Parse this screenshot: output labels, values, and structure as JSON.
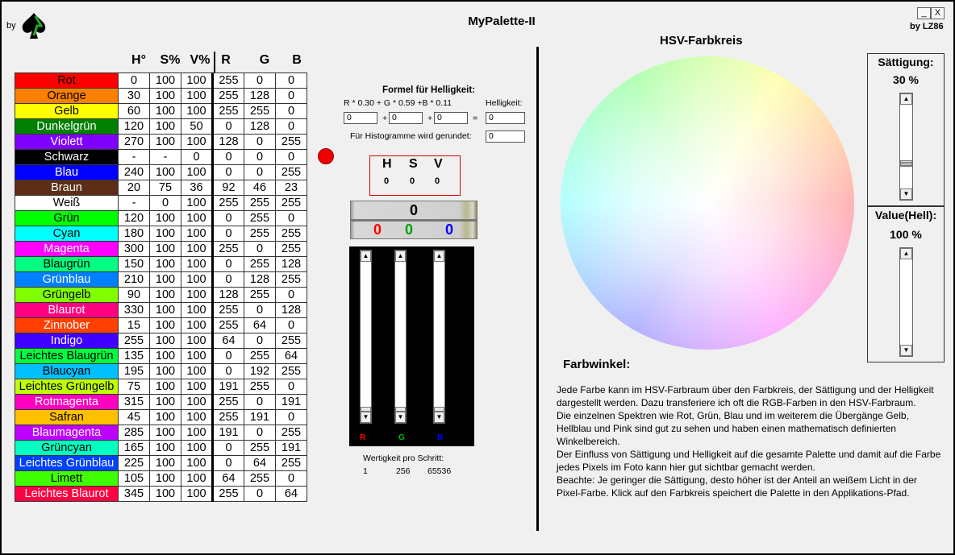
{
  "header": {
    "by_left": "by",
    "title": "MyPalette-II",
    "by_right": "by LZ86",
    "min_label": "_",
    "close_label": "X"
  },
  "table": {
    "headers": [
      "H°",
      "S%",
      "V%",
      "R",
      "G",
      "B"
    ],
    "rows": [
      {
        "name": "Rot",
        "bg": "#ff0000",
        "fg": "#000000",
        "h": "0",
        "s": "100",
        "v": "100",
        "r": "255",
        "g": "0",
        "b": "0"
      },
      {
        "name": "Orange",
        "bg": "#ff8000",
        "fg": "#000000",
        "h": "30",
        "s": "100",
        "v": "100",
        "r": "255",
        "g": "128",
        "b": "0"
      },
      {
        "name": "Gelb",
        "bg": "#ffff00",
        "fg": "#000000",
        "h": "60",
        "s": "100",
        "v": "100",
        "r": "255",
        "g": "255",
        "b": "0"
      },
      {
        "name": "Dunkelgrün",
        "bg": "#008000",
        "fg": "#ffffff",
        "h": "120",
        "s": "100",
        "v": "50",
        "r": "0",
        "g": "128",
        "b": "0"
      },
      {
        "name": "Violett",
        "bg": "#8000ff",
        "fg": "#ffffff",
        "h": "270",
        "s": "100",
        "v": "100",
        "r": "128",
        "g": "0",
        "b": "255"
      },
      {
        "name": "Schwarz",
        "bg": "#000000",
        "fg": "#ffffff",
        "h": "-",
        "s": "-",
        "v": "0",
        "r": "0",
        "g": "0",
        "b": "0"
      },
      {
        "name": "Blau",
        "bg": "#0000ff",
        "fg": "#ffffff",
        "h": "240",
        "s": "100",
        "v": "100",
        "r": "0",
        "g": "0",
        "b": "255"
      },
      {
        "name": "Braun",
        "bg": "#5c2e17",
        "fg": "#ffffff",
        "h": "20",
        "s": "75",
        "v": "36",
        "r": "92",
        "g": "46",
        "b": "23"
      },
      {
        "name": "Weiß",
        "bg": "#ffffff",
        "fg": "#000000",
        "h": "-",
        "s": "0",
        "v": "100",
        "r": "255",
        "g": "255",
        "b": "255"
      },
      {
        "name": "Grün",
        "bg": "#00ff00",
        "fg": "#000000",
        "h": "120",
        "s": "100",
        "v": "100",
        "r": "0",
        "g": "255",
        "b": "0"
      },
      {
        "name": "Cyan",
        "bg": "#00ffff",
        "fg": "#000000",
        "h": "180",
        "s": "100",
        "v": "100",
        "r": "0",
        "g": "255",
        "b": "255"
      },
      {
        "name": "Magenta",
        "bg": "#ff00ff",
        "fg": "#ffffff",
        "h": "300",
        "s": "100",
        "v": "100",
        "r": "255",
        "g": "0",
        "b": "255"
      },
      {
        "name": "Blaugrün",
        "bg": "#00ff80",
        "fg": "#000000",
        "h": "150",
        "s": "100",
        "v": "100",
        "r": "0",
        "g": "255",
        "b": "128"
      },
      {
        "name": "Grünblau",
        "bg": "#0080ff",
        "fg": "#ffffff",
        "h": "210",
        "s": "100",
        "v": "100",
        "r": "0",
        "g": "128",
        "b": "255"
      },
      {
        "name": "Grüngelb",
        "bg": "#80ff00",
        "fg": "#000000",
        "h": "90",
        "s": "100",
        "v": "100",
        "r": "128",
        "g": "255",
        "b": "0"
      },
      {
        "name": "Blaurot",
        "bg": "#ff0080",
        "fg": "#ffffff",
        "h": "330",
        "s": "100",
        "v": "100",
        "r": "255",
        "g": "0",
        "b": "128"
      },
      {
        "name": "Zinnober",
        "bg": "#ff4000",
        "fg": "#ffffff",
        "h": "15",
        "s": "100",
        "v": "100",
        "r": "255",
        "g": "64",
        "b": "0"
      },
      {
        "name": "Indigo",
        "bg": "#4000ff",
        "fg": "#ffffff",
        "h": "255",
        "s": "100",
        "v": "100",
        "r": "64",
        "g": "0",
        "b": "255"
      },
      {
        "name": "Leichtes Blaugrün",
        "bg": "#00ff40",
        "fg": "#000000",
        "h": "135",
        "s": "100",
        "v": "100",
        "r": "0",
        "g": "255",
        "b": "64"
      },
      {
        "name": "Blaucyan",
        "bg": "#00c0ff",
        "fg": "#000000",
        "h": "195",
        "s": "100",
        "v": "100",
        "r": "0",
        "g": "192",
        "b": "255"
      },
      {
        "name": "Leichtes Grüngelb",
        "bg": "#c0ff00",
        "fg": "#000000",
        "h": "75",
        "s": "100",
        "v": "100",
        "r": "191",
        "g": "255",
        "b": "0"
      },
      {
        "name": "Rotmagenta",
        "bg": "#ff00c0",
        "fg": "#ffffff",
        "h": "315",
        "s": "100",
        "v": "100",
        "r": "255",
        "g": "0",
        "b": "191"
      },
      {
        "name": "Safran",
        "bg": "#ffc000",
        "fg": "#000000",
        "h": "45",
        "s": "100",
        "v": "100",
        "r": "255",
        "g": "191",
        "b": "0"
      },
      {
        "name": "Blaumagenta",
        "bg": "#c000ff",
        "fg": "#ffffff",
        "h": "285",
        "s": "100",
        "v": "100",
        "r": "191",
        "g": "0",
        "b": "255"
      },
      {
        "name": "Grüncyan",
        "bg": "#00ffc0",
        "fg": "#000000",
        "h": "165",
        "s": "100",
        "v": "100",
        "r": "0",
        "g": "255",
        "b": "191"
      },
      {
        "name": "Leichtes Grünblau",
        "bg": "#0040ff",
        "fg": "#ffffff",
        "h": "225",
        "s": "100",
        "v": "100",
        "r": "0",
        "g": "64",
        "b": "255"
      },
      {
        "name": "Limett",
        "bg": "#40ff00",
        "fg": "#000000",
        "h": "105",
        "s": "100",
        "v": "100",
        "r": "64",
        "g": "255",
        "b": "0"
      },
      {
        "name": "Leichtes Blaurot",
        "bg": "#ff0040",
        "fg": "#ffffff",
        "h": "345",
        "s": "100",
        "v": "100",
        "r": "255",
        "g": "0",
        "b": "64"
      }
    ]
  },
  "formula": {
    "title": "Formel für Helligkeit:",
    "expression": "R * 0.30  +  G * 0.59  +B  * 0.11",
    "helligkeit_label": "Helligkeit:",
    "r_value": "0",
    "g_value": "0",
    "b_value": "0",
    "result_value": "0",
    "plus": "+",
    "equals": "=",
    "hist_label": "Für Histogramme wird gerundet:",
    "hist_value": "0"
  },
  "hsv_display": {
    "h_label": "H",
    "s_label": "S",
    "v_label": "V",
    "h_value": "0",
    "s_value": "0",
    "v_value": "0"
  },
  "value_display": {
    "top": "0",
    "r": "0",
    "g": "0",
    "b": "0"
  },
  "rgb_sliders": {
    "r_label": "R",
    "g_label": "G",
    "b_label": "B",
    "r_level": 0,
    "g_level": 0,
    "b_level": 0
  },
  "wertigkeit": {
    "label": "Wertigkeit pro Schritt:",
    "values": [
      "1",
      "256",
      "65536"
    ]
  },
  "wheel": {
    "title": "HSV-Farbkreis"
  },
  "saturation": {
    "title": "Sättigung:",
    "value": "30 %",
    "level": 0.3
  },
  "value_hell": {
    "title": "Value(Hell):",
    "value": "100 %",
    "level": 1.0
  },
  "farbwinkel": {
    "title": "Farbwinkel:",
    "paragraphs": [
      "Jede Farbe kann im HSV-Farbraum über den Farbkreis, der Sättigung und der Helligkeit dargestellt werden. Dazu transferiere ich oft die RGB-Farben in den HSV-Farbraum.",
      "Die einzelnen Spektren wie Rot, Grün, Blau und im weiterem die Übergänge Gelb, Hellblau und Pink sind gut zu sehen und haben einen mathematisch definierten Winkelbereich.",
      "Der Einfluss von Sättigung und Helligkeit auf die gesamte Palette und damit auf die Farbe jedes Pixels im Foto kann hier gut sichtbar gemacht werden.",
      "Beachte: Je geringer die Sättigung, desto höher ist der Anteil an weißem Licht in der Pixel-Farbe. Klick auf den Farbkreis speichert die Palette in den Applikations-Pfad."
    ]
  },
  "colors": {
    "accent_red": "#dd0000",
    "r_text": "#ff0000",
    "g_text": "#00a000",
    "b_text": "#0000ff"
  },
  "icons": {
    "logo": "spade-logo-icon",
    "scroll_up": "arrow-up-icon",
    "scroll_down": "arrow-down-icon"
  }
}
